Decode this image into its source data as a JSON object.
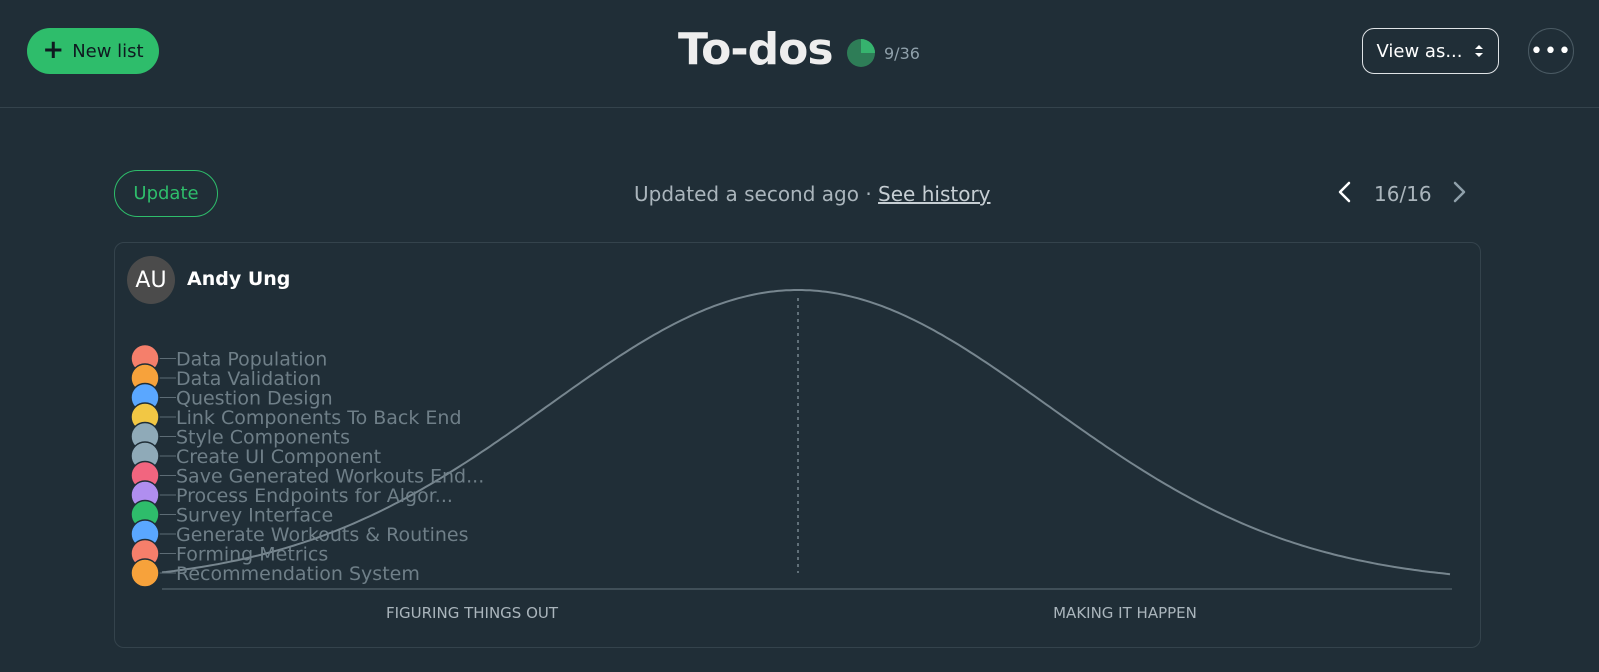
{
  "header": {
    "new_list_label": "New list",
    "title": "To-dos",
    "progress_text": "9/36",
    "progress_fraction": 0.25,
    "view_as_label": "View as...",
    "more_label": "•••"
  },
  "toolbar": {
    "update_label": "Update",
    "updated_text": "Updated a second ago · ",
    "see_history_label": "See history",
    "pager_text": "16/16"
  },
  "card": {
    "avatar_initials": "AU",
    "user_name": "Andy Ung"
  },
  "hill_chart": {
    "left_label": "FIGURING THINGS OUT",
    "right_label": "MAKING IT HAPPEN",
    "tasks": [
      {
        "label": "Data Population",
        "color": "#f57f6b"
      },
      {
        "label": "Data Validation",
        "color": "#f7a23b"
      },
      {
        "label": "Question Design",
        "color": "#5aa7ff"
      },
      {
        "label": "Link Components To Back End",
        "color": "#f2c744"
      },
      {
        "label": "Style Components",
        "color": "#8faab8"
      },
      {
        "label": "Create UI Component",
        "color": "#8faab8"
      },
      {
        "label": "Save Generated Workouts End...",
        "color": "#f2657f"
      },
      {
        "label": "Process Endpoints for Algor...",
        "color": "#b08ef0"
      },
      {
        "label": "Survey Interface",
        "color": "#2ebd6b"
      },
      {
        "label": "Generate Workouts & Routines",
        "color": "#5aa7ff"
      },
      {
        "label": "Forming Metrics",
        "color": "#f57f6b"
      },
      {
        "label": "Recommendation System",
        "color": "#f7a23b"
      }
    ]
  },
  "colors": {
    "accent": "#2ebd6b",
    "background": "#202e37",
    "curve": "#77868f"
  },
  "icons": {
    "new_list": "plus-icon",
    "view_as": "up-down-chevron-icon",
    "more": "ellipsis-icon",
    "prev": "chevron-left-icon",
    "next": "chevron-right-icon"
  }
}
